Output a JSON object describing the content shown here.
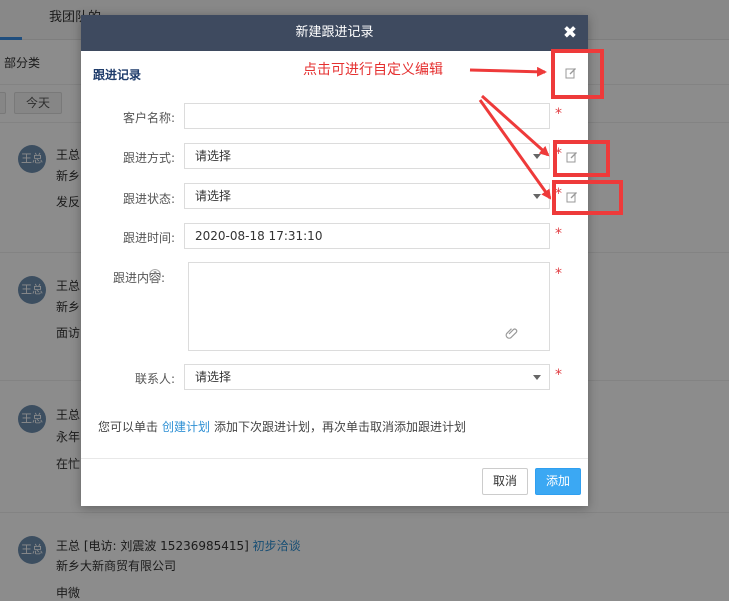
{
  "background": {
    "tab_label": "我团队的",
    "section_label": "部分类",
    "filter_buttons": [
      "",
      "今天"
    ],
    "records": [
      {
        "avatar": "王总",
        "line1": "王总",
        "line2": "新乡",
        "line3": "发反"
      },
      {
        "avatar": "王总",
        "line1": "王总",
        "line2": "新乡",
        "line3": "面访"
      },
      {
        "avatar": "王总",
        "line1": "王总",
        "line2": "永年",
        "line3": "在忙"
      },
      {
        "avatar": "王总",
        "line1": "王总 [电访: 刘震波 15236985415]",
        "status": "初步洽谈",
        "line2": "新乡大新商贸有限公司",
        "line3": "申微"
      }
    ]
  },
  "modal": {
    "title": "新建跟进记录",
    "close_label": "✖",
    "section_title": "跟进记录",
    "fields": {
      "customer_name": {
        "label": "客户名称:",
        "value": ""
      },
      "follow_method": {
        "label": "跟进方式:",
        "placeholder": "请选择"
      },
      "follow_status": {
        "label": "跟进状态:",
        "placeholder": "请选择"
      },
      "follow_time": {
        "label": "跟进时间:",
        "value": "2020-08-18 17:31:10"
      },
      "follow_content": {
        "label": "跟进内容:",
        "help": "?"
      },
      "contact": {
        "label": "联系人:",
        "placeholder": "请选择"
      }
    },
    "required_mark": "*",
    "hint": {
      "before": "您可以单击",
      "link": "创建计划",
      "after": "添加下次跟进计划，再次单击取消添加跟进计划"
    },
    "buttons": {
      "cancel": "取消",
      "add": "添加"
    }
  },
  "annotation": {
    "text": "点击可进行自定义编辑",
    "color": "#e53030"
  },
  "icons": {
    "edit": "edit-square-icon",
    "attachment": "paperclip-icon",
    "help": "question-circle-icon",
    "close": "close-icon"
  }
}
